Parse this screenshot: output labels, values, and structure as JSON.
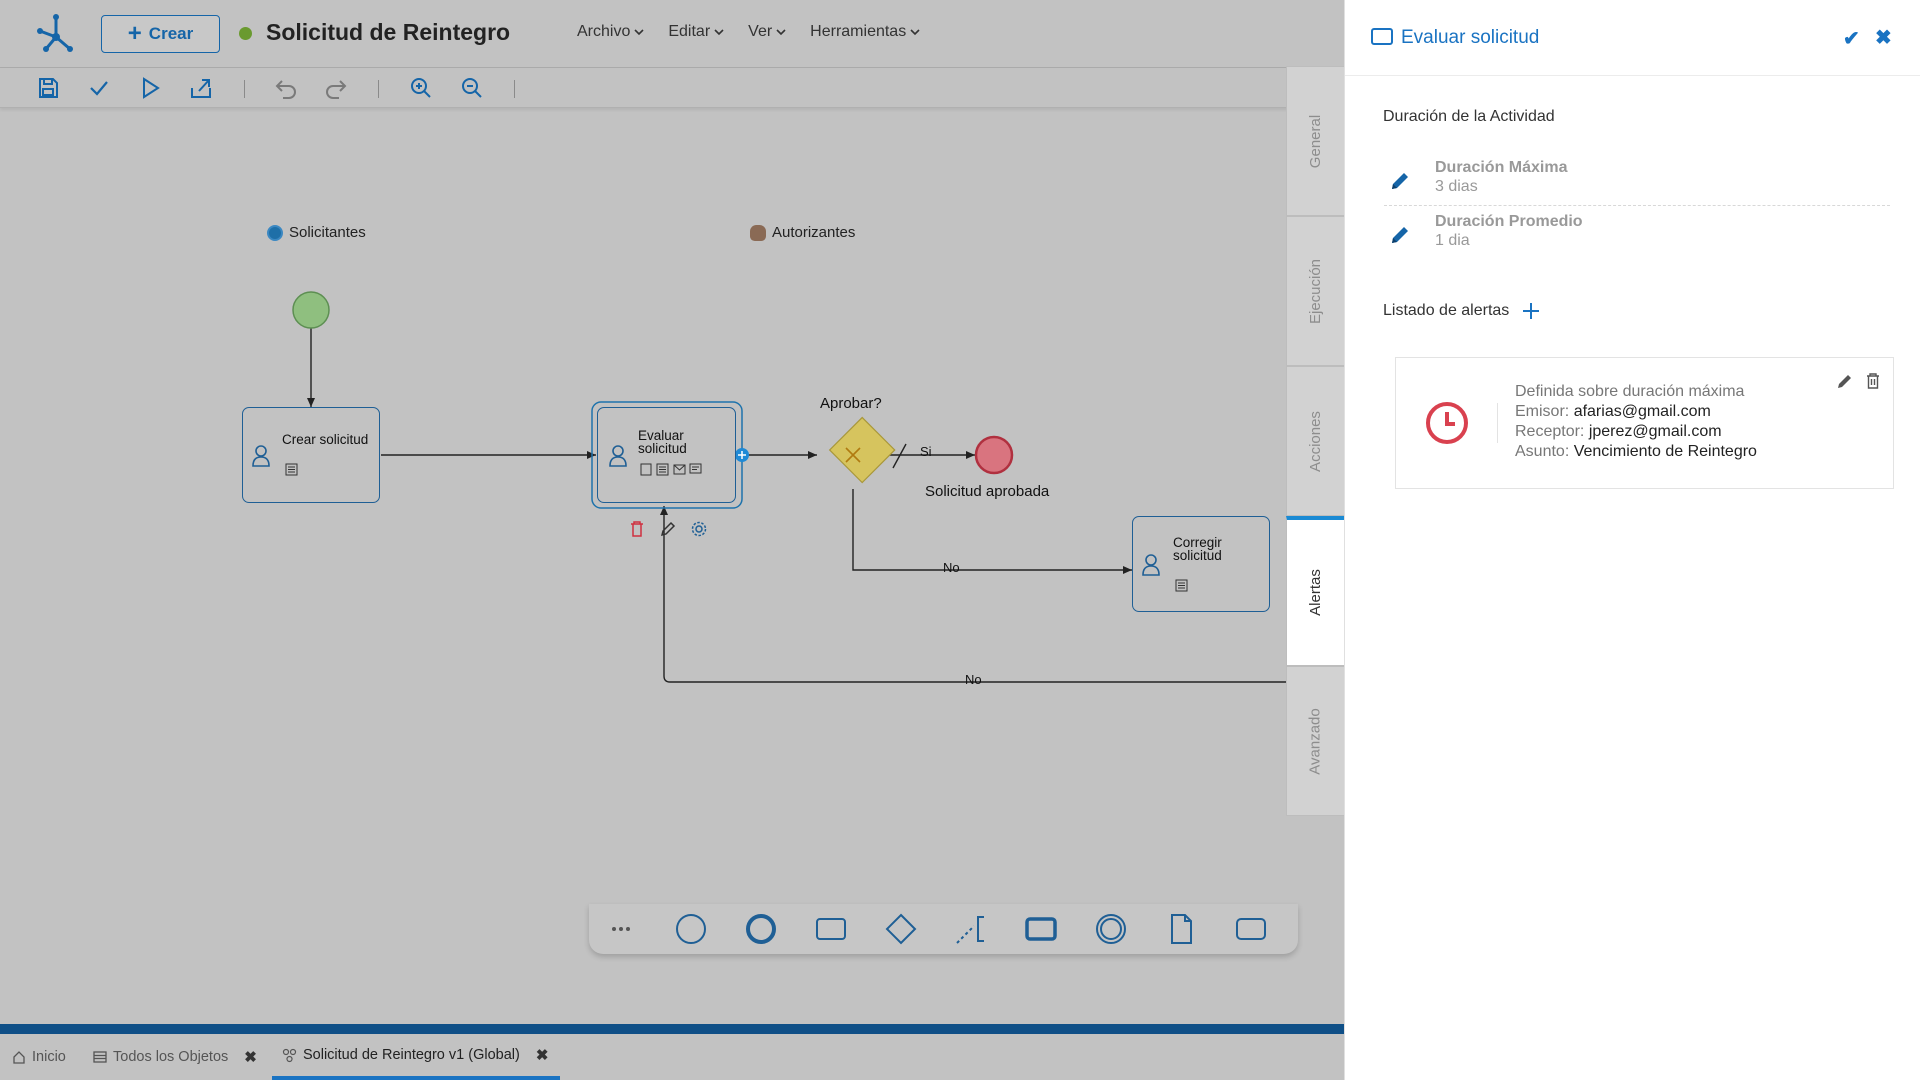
{
  "app": {
    "create_label": "Crear",
    "process_title": "Solicitud de Reintegro",
    "menus": [
      "Archivo",
      "Editar",
      "Ver",
      "Herramientas"
    ]
  },
  "diagram": {
    "lanes": [
      "Solicitantes",
      "Autorizantes"
    ],
    "tasks": {
      "crear": "Crear solicitud",
      "evaluar_line1": "Evaluar",
      "evaluar_line2": "solicitud",
      "corregir_line1": "Corregir",
      "corregir_line2": "solicitud"
    },
    "gateway_label": "Aprobar?",
    "end_label": "Solicitud aprobada",
    "flow_labels": {
      "si": "Si",
      "no1": "No",
      "no2": "No"
    }
  },
  "bottom_tabs": [
    {
      "label": "Inicio",
      "icon": "home-icon"
    },
    {
      "label": "Todos los Objetos",
      "icon": "list-icon"
    },
    {
      "label": "Solicitud de Reintegro v1 (Global)",
      "icon": "process-icon"
    }
  ],
  "side_tabs": [
    "General",
    "Ejecución",
    "Acciones",
    "Alertas",
    "Avanzado"
  ],
  "side_tab_active": "Alertas",
  "panel": {
    "title": "Evaluar solicitud",
    "activity_duration_title": "Duración de la Actividad",
    "max_duration_label": "Duración Máxima",
    "max_duration_value": "3 dias",
    "avg_duration_label": "Duración Promedio",
    "avg_duration_value": "1 dia",
    "alerts_title": "Listado de alertas",
    "alert": {
      "definition": "Definida sobre duración máxima",
      "sender_label": "Emisor:",
      "sender": "afarias@gmail.com",
      "receiver_label": "Receptor:",
      "receiver": "jperez@gmail.com",
      "subject_label": "Asunto:",
      "subject": "Vencimiento de Reintegro"
    }
  },
  "colors": {
    "accent": "#1a73c2",
    "start_event": "#8fbf7f",
    "end_event": "#d9747f",
    "gateway": "#d6c45e",
    "alert_clock": "#d9414f"
  }
}
